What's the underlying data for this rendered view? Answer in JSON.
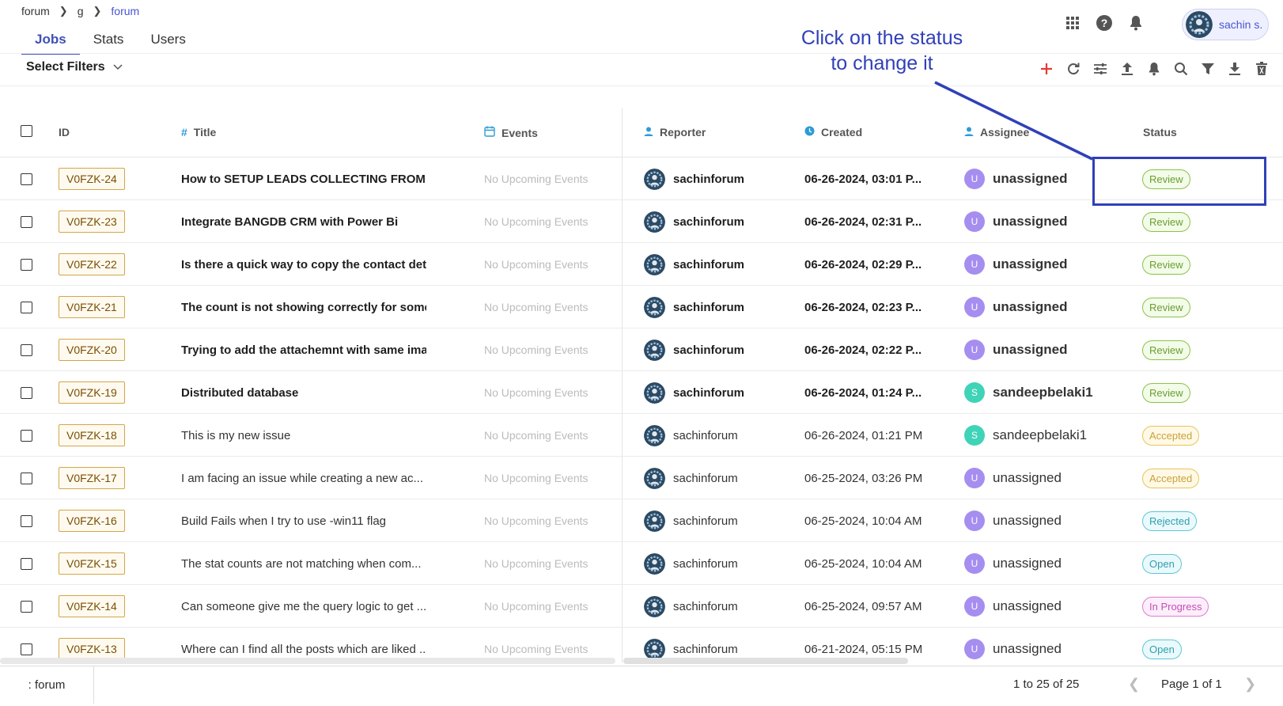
{
  "breadcrumb": [
    "forum",
    "g",
    "forum"
  ],
  "tabs": [
    {
      "label": "Jobs",
      "active": true
    },
    {
      "label": "Stats",
      "active": false
    },
    {
      "label": "Users",
      "active": false
    }
  ],
  "user": {
    "name": "sachin s."
  },
  "filters": {
    "label": "Select Filters"
  },
  "annotation": {
    "line1": "Click on the status",
    "line2": "to change it"
  },
  "columns": {
    "id": "ID",
    "title": "Title",
    "events": "Events",
    "reporter": "Reporter",
    "created": "Created",
    "assignee": "Assignee",
    "status": "Status"
  },
  "status_colors": {
    "Review": {
      "border": "#8bc34a",
      "bg": "#f3fbe9",
      "text": "#6a9f2f"
    },
    "Accepted": {
      "border": "#e6c45c",
      "bg": "#fff9e6",
      "text": "#c9a23a"
    },
    "Rejected": {
      "border": "#5fc6d6",
      "bg": "#eaf9fb",
      "text": "#2f9fb1"
    },
    "Open": {
      "border": "#5fc6d6",
      "bg": "#eaf9fb",
      "text": "#2f9fb1"
    },
    "In Progress": {
      "border": "#e07ad0",
      "bg": "#fdeefb",
      "text": "#c34fb4"
    }
  },
  "rows": [
    {
      "id": "V0FZK-24",
      "title": "How to SETUP LEADS COLLECTING FROM B...",
      "events": "No Upcoming Events",
      "reporter": "sachinforum",
      "created": "06-26-2024, 03:01 P...",
      "assignee": "unassigned",
      "assignee_letter": "U",
      "status": "Review",
      "bold": true
    },
    {
      "id": "V0FZK-23",
      "title": "Integrate BANGDB CRM with Power Bi",
      "events": "No Upcoming Events",
      "reporter": "sachinforum",
      "created": "06-26-2024, 02:31 P...",
      "assignee": "unassigned",
      "assignee_letter": "U",
      "status": "Review",
      "bold": true
    },
    {
      "id": "V0FZK-22",
      "title": "Is there a quick way to copy the contact det...",
      "events": "No Upcoming Events",
      "reporter": "sachinforum",
      "created": "06-26-2024, 02:29 P...",
      "assignee": "unassigned",
      "assignee_letter": "U",
      "status": "Review",
      "bold": true
    },
    {
      "id": "V0FZK-21",
      "title": "The count is not showing correctly for some...",
      "events": "No Upcoming Events",
      "reporter": "sachinforum",
      "created": "06-26-2024, 02:23 P...",
      "assignee": "unassigned",
      "assignee_letter": "U",
      "status": "Review",
      "bold": true
    },
    {
      "id": "V0FZK-20",
      "title": "Trying to add the attachemnt with same ima...",
      "events": "No Upcoming Events",
      "reporter": "sachinforum",
      "created": "06-26-2024, 02:22 P...",
      "assignee": "unassigned",
      "assignee_letter": "U",
      "status": "Review",
      "bold": true
    },
    {
      "id": "V0FZK-19",
      "title": "Distributed database",
      "events": "No Upcoming Events",
      "reporter": "sachinforum",
      "created": "06-26-2024, 01:24 P...",
      "assignee": "sandeepbelaki1",
      "assignee_letter": "S",
      "status": "Review",
      "bold": true
    },
    {
      "id": "V0FZK-18",
      "title": "This is my new issue",
      "events": "No Upcoming Events",
      "reporter": "sachinforum",
      "created": "06-26-2024, 01:21 PM",
      "assignee": "sandeepbelaki1",
      "assignee_letter": "S",
      "status": "Accepted",
      "bold": false
    },
    {
      "id": "V0FZK-17",
      "title": "I am facing an issue while creating a new ac...",
      "events": "No Upcoming Events",
      "reporter": "sachinforum",
      "created": "06-25-2024, 03:26 PM",
      "assignee": "unassigned",
      "assignee_letter": "U",
      "status": "Accepted",
      "bold": false
    },
    {
      "id": "V0FZK-16",
      "title": "Build Fails when I try to use -win11 flag",
      "events": "No Upcoming Events",
      "reporter": "sachinforum",
      "created": "06-25-2024, 10:04 AM",
      "assignee": "unassigned",
      "assignee_letter": "U",
      "status": "Rejected",
      "bold": false
    },
    {
      "id": "V0FZK-15",
      "title": "The stat counts are not matching when com...",
      "events": "No Upcoming Events",
      "reporter": "sachinforum",
      "created": "06-25-2024, 10:04 AM",
      "assignee": "unassigned",
      "assignee_letter": "U",
      "status": "Open",
      "bold": false
    },
    {
      "id": "V0FZK-14",
      "title": "Can someone give me the query logic to get ...",
      "events": "No Upcoming Events",
      "reporter": "sachinforum",
      "created": "06-25-2024, 09:57 AM",
      "assignee": "unassigned",
      "assignee_letter": "U",
      "status": "In Progress",
      "bold": false
    },
    {
      "id": "V0FZK-13",
      "title": "Where can I find all the posts which are liked ...",
      "events": "No Upcoming Events",
      "reporter": "sachinforum",
      "created": "06-21-2024, 05:15 PM",
      "assignee": "unassigned",
      "assignee_letter": "U",
      "status": "Open",
      "bold": false
    }
  ],
  "letter_colors": {
    "U": "#a58ef0",
    "S": "#3fd3b8"
  },
  "footer": {
    "left": ": forum",
    "range": "1 to 25 of 25",
    "page": "Page 1 of 1"
  }
}
